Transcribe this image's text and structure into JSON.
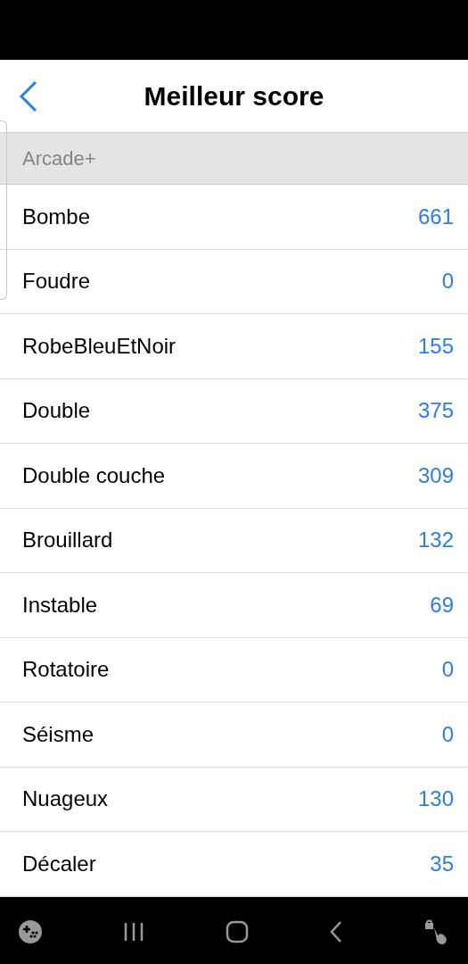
{
  "header": {
    "title": "Meilleur score"
  },
  "section": {
    "title": "Arcade+"
  },
  "rows": [
    {
      "name": "Bombe",
      "score": "661"
    },
    {
      "name": "Foudre",
      "score": "0"
    },
    {
      "name": "RobeBleuEtNoir",
      "score": "155"
    },
    {
      "name": "Double",
      "score": "375"
    },
    {
      "name": "Double couche",
      "score": "309"
    },
    {
      "name": "Brouillard",
      "score": "132"
    },
    {
      "name": "Instable",
      "score": "69"
    },
    {
      "name": "Rotatoire",
      "score": "0"
    },
    {
      "name": "Séisme",
      "score": "0"
    },
    {
      "name": "Nuageux",
      "score": "130"
    },
    {
      "name": "Décaler",
      "score": "35"
    }
  ]
}
